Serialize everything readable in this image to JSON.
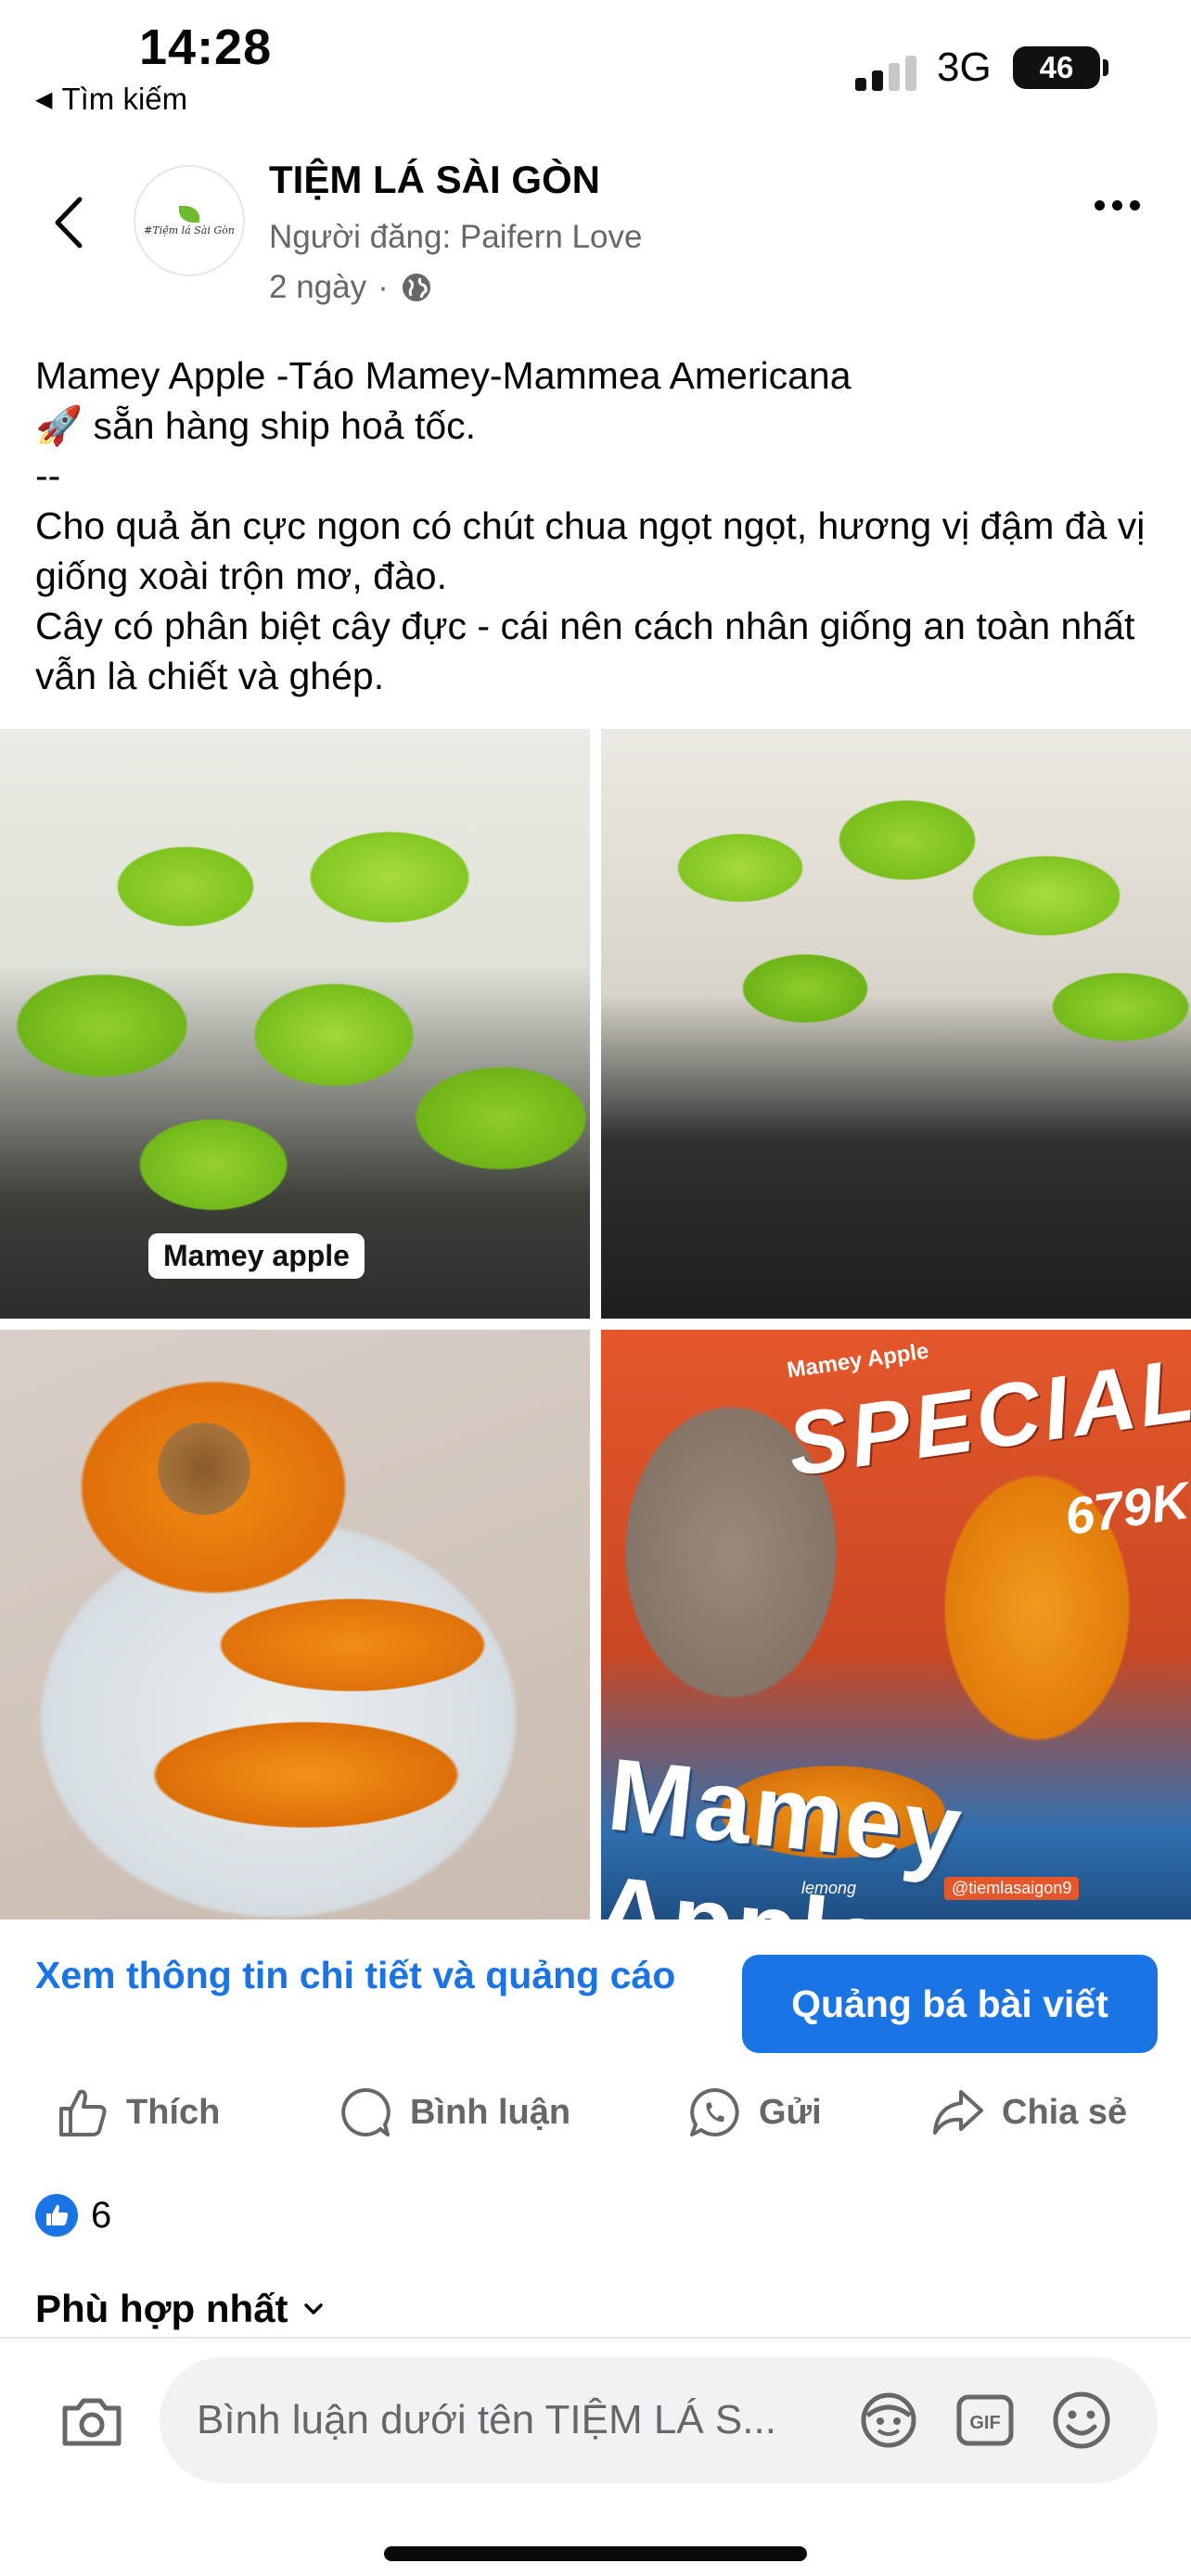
{
  "status_bar": {
    "time": "14:28",
    "back_app_label": "Tìm kiếm",
    "network": "3G",
    "battery": "46"
  },
  "post": {
    "page_name": "TIỆM LÁ SÀI GÒN",
    "avatar_text": "#Tiệm lá Sài Gòn",
    "author": "Người đăng: Paifern Love",
    "time_ago": "2 ngày",
    "privacy_icon": "globe-icon",
    "text_lines": [
      "Mamey Apple -Táo Mamey-Mammea Americana",
      "🚀 sẵn hàng ship hoả tốc.",
      "--",
      "Cho quả ăn cực ngon có chút chua ngọt ngọt, hương vị đậm đà vị giống xoài trộn mơ, đào.",
      "Cây có phân biệt cây đực - cái nên cách nhân giống an toàn nhất vẫn là chiết và ghép."
    ],
    "photos": {
      "photo1_label": "Mamey apple",
      "photo4_brand": "Mamey Apple",
      "photo4_special": "SPECIAL",
      "photo4_price": "679K",
      "photo4_mamey": "Mamey Apple",
      "photo4_logo": "lemong",
      "photo4_watermark": "@tiemlasaigon9"
    }
  },
  "cta": {
    "details_link": "Xem thông tin chi tiết và quảng cáo",
    "boost_button": "Quảng bá bài viết"
  },
  "actions": {
    "like": "Thích",
    "comment": "Bình luận",
    "send": "Gửi",
    "share": "Chia sẻ"
  },
  "reactions": {
    "count": "6"
  },
  "sort": {
    "label": "Phù hợp nhất"
  },
  "comment_bar": {
    "placeholder": "Bình luận dưới tên TIỆM LÁ S..."
  },
  "colors": {
    "accent": "#1b74e4",
    "secondary_text": "#65676b"
  }
}
